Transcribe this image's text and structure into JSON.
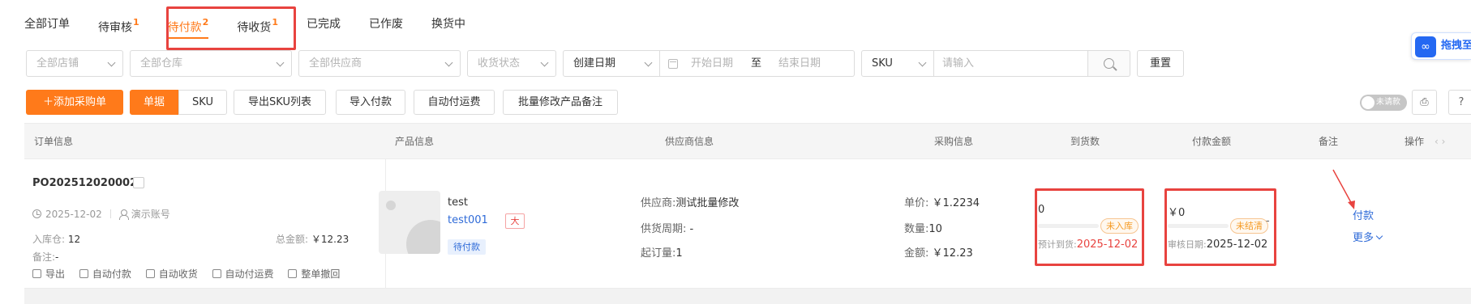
{
  "tabs": [
    {
      "label": "全部订单"
    },
    {
      "label": "待审核",
      "count": "1"
    },
    {
      "label": "待付款",
      "count": "2"
    },
    {
      "label": "待收货",
      "count": "1"
    },
    {
      "label": "已完成"
    },
    {
      "label": "已作废"
    },
    {
      "label": "换货中"
    }
  ],
  "filters": {
    "store": "全部店铺",
    "warehouse": "全部仓库",
    "supplier": "全部供应商",
    "receive_status": "收货状态",
    "date_type": "创建日期",
    "start_date": "开始日期",
    "date_sep": "至",
    "end_date": "结束日期",
    "search_field": "SKU",
    "search_placeholder": "请输入",
    "reset": "重置"
  },
  "float_widget": {
    "logo": "∞",
    "text": "拖拽至此"
  },
  "actions": {
    "add": "＋添加采购单",
    "view_document": "单据",
    "view_sku": "SKU",
    "export_sku": "导出SKU列表",
    "import_payment": "导入付款",
    "auto_freight": "自动付运费",
    "batch_remark": "批量修改产品备注",
    "toggle_label": "未请款",
    "print_icon": "⎙",
    "help_icon": "?"
  },
  "table": {
    "headers": {
      "order": "订单信息",
      "product": "产品信息",
      "supplier": "供应商信息",
      "purchase": "采购信息",
      "arrival": "到货数",
      "payment": "付款金额",
      "remark": "备注",
      "action": "操作",
      "pager": "‹ ›"
    },
    "row": {
      "order_no": "PO202512020002",
      "date": "2025-12-02",
      "account": "演示账号",
      "warehouse_label": "入库仓:",
      "warehouse": "12",
      "total_label": "总金额:",
      "total": "￥12.23",
      "remark_label": "备注:",
      "remark": "-",
      "ops": [
        "导出",
        "自动付款",
        "自动收货",
        "自动付运费",
        "整单撤回"
      ],
      "product_name": "test",
      "product_sku": "test001",
      "size_badge": "大",
      "status_badge": "待付款",
      "supplier_label": "供应商:",
      "supplier": "测试批量修改",
      "cycle_label": "供货周期:",
      "cycle": "-",
      "moq_label": "起订量:",
      "moq": "1",
      "unit_price_label": "单价:",
      "unit_price": "￥1.2234",
      "qty_label": "数量:",
      "qty": "10",
      "amount_label": "金额:",
      "amount": "￥12.23",
      "arrived": "0",
      "arrival_status": "未入库",
      "expected_label": "预计到货:",
      "expected_date": "2025-12-02",
      "paid": "￥0",
      "payment_status": "未结清",
      "audit_label": "审核日期:",
      "audit_date": "2025-12-02",
      "remark_col": "-",
      "action_pay": "付款",
      "action_more": "更多"
    }
  },
  "colors": {
    "accent": "#ff7a1a",
    "link": "#2f6bd8",
    "highlight_box": "#e8433f",
    "warning": "#f59a23"
  }
}
